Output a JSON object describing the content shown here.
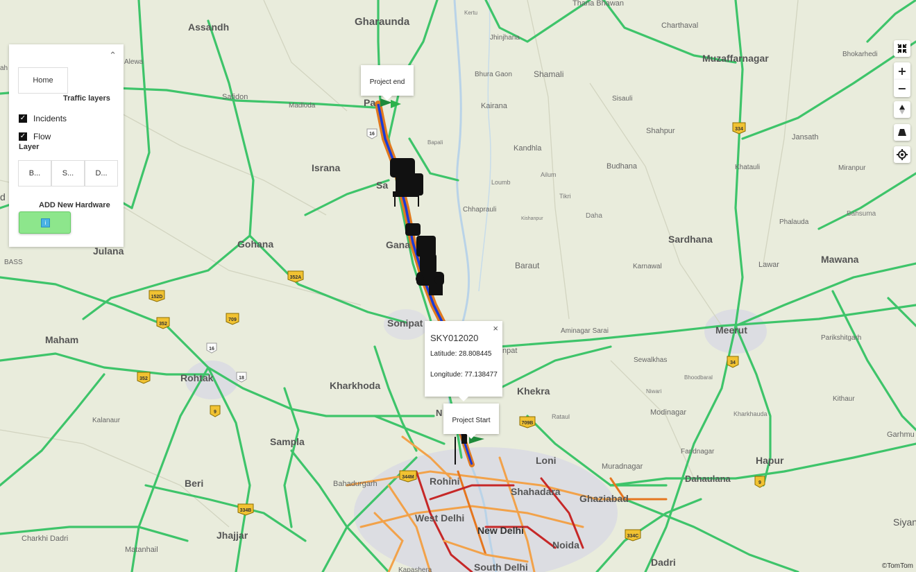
{
  "panel": {
    "home_label": "Home",
    "traffic_layers_title": "Traffic layers",
    "incidents_label": "Incidents",
    "flow_label": "Flow",
    "layer_title": "Layer",
    "layer_buttons": [
      "B...",
      "S...",
      "D..."
    ],
    "add_hardware_label": "ADD New Hardware"
  },
  "popups": {
    "project_end": "Project end",
    "project_start": "Project Start",
    "device": {
      "title": "SKY012020",
      "latitude": "Latitude: 28.808445",
      "longitude": "Longitude: 77.138477",
      "close": "×"
    }
  },
  "attribution": "©TomTom",
  "colors": {
    "highway": "#3ec46a",
    "route": "#e07a20",
    "route_core": "#1a3ad6",
    "traffic_orange": "#f2a24a",
    "traffic_red": "#c62828",
    "button_green": "#8de68c"
  },
  "icons": [
    "collapse-icon",
    "fullscreen-exit-icon",
    "zoom-in-icon",
    "zoom-out-icon",
    "compass-icon",
    "pitch-icon",
    "locate-icon"
  ],
  "places": [
    {
      "name": "Gharaunda",
      "size": "city"
    },
    {
      "name": "Assandh",
      "size": "city"
    },
    {
      "name": "Muzaffarnagar",
      "size": "city"
    },
    {
      "name": "Charthaval",
      "size": "town"
    },
    {
      "name": "Bhokarhedi",
      "size": "town"
    },
    {
      "name": "Kertu",
      "size": "small"
    },
    {
      "name": "Thana Bhawan",
      "size": "town"
    },
    {
      "name": "Jhinjhana",
      "size": "town"
    },
    {
      "name": "Bhura Gaon",
      "size": "town"
    },
    {
      "name": "Shamali",
      "size": "city"
    },
    {
      "name": "Alewa",
      "size": "town"
    },
    {
      "name": "Safidon",
      "size": "town"
    },
    {
      "name": "Madloda",
      "size": "town"
    },
    {
      "name": "Pa",
      "size": "city"
    },
    {
      "name": "Kairana",
      "size": "town"
    },
    {
      "name": "Sisauli",
      "size": "town"
    },
    {
      "name": "Bapali",
      "size": "small"
    },
    {
      "name": "Shahpur",
      "size": "town"
    },
    {
      "name": "Jansath",
      "size": "town"
    },
    {
      "name": "Kandhla",
      "size": "town"
    },
    {
      "name": "Israna",
      "size": "city"
    },
    {
      "name": "Budhana",
      "size": "town"
    },
    {
      "name": "Khatauli",
      "size": "town"
    },
    {
      "name": "Miranpur",
      "size": "town"
    },
    {
      "name": "Sa",
      "size": "city"
    },
    {
      "name": "Loumb",
      "size": "small"
    },
    {
      "name": "Ailum",
      "size": "small"
    },
    {
      "name": "Tikri",
      "size": "small"
    },
    {
      "name": "Chhaprauli",
      "size": "town"
    },
    {
      "name": "Kishanpur",
      "size": "small"
    },
    {
      "name": "Daha",
      "size": "small"
    },
    {
      "name": "Bahsuma",
      "size": "small"
    },
    {
      "name": "Phalauda",
      "size": "town"
    },
    {
      "name": "Gohana",
      "size": "city"
    },
    {
      "name": "Gana",
      "size": "city"
    },
    {
      "name": "Sardhana",
      "size": "city"
    },
    {
      "name": "Julana",
      "size": "city"
    },
    {
      "name": "BASS",
      "size": "small"
    },
    {
      "name": "Baraut",
      "size": "town"
    },
    {
      "name": "Karnawal",
      "size": "town"
    },
    {
      "name": "Lawar",
      "size": "town"
    },
    {
      "name": "Mawana",
      "size": "city"
    },
    {
      "name": "Sonipat",
      "size": "city"
    },
    {
      "name": "Aminagar Sarai",
      "size": "town"
    },
    {
      "name": "Meerut",
      "size": "city"
    },
    {
      "name": "Parikshitgarh",
      "size": "town"
    },
    {
      "name": "Maham",
      "size": "city"
    },
    {
      "name": "npat",
      "size": "town"
    },
    {
      "name": "Sewalkhas",
      "size": "town"
    },
    {
      "name": "Bhoodbaral",
      "size": "small"
    },
    {
      "name": "Rohtak",
      "size": "city"
    },
    {
      "name": "Kharkhoda",
      "size": "city"
    },
    {
      "name": "Khekra",
      "size": "city"
    },
    {
      "name": "Niwari",
      "size": "small"
    },
    {
      "name": "Modinagar",
      "size": "town"
    },
    {
      "name": "Kithaur",
      "size": "town"
    },
    {
      "name": "Kalanaur",
      "size": "town"
    },
    {
      "name": "Rataul",
      "size": "small"
    },
    {
      "name": "Kharkhauda",
      "size": "town"
    },
    {
      "name": "Garhmu",
      "size": "town"
    },
    {
      "name": "Sampla",
      "size": "city"
    },
    {
      "name": "N",
      "size": "city"
    },
    {
      "name": "Loni",
      "size": "city"
    },
    {
      "name": "Faridnagar",
      "size": "town"
    },
    {
      "name": "Muradnagar",
      "size": "town"
    },
    {
      "name": "Hapur",
      "size": "city"
    },
    {
      "name": "Beri",
      "size": "city"
    },
    {
      "name": "Bahadurgarh",
      "size": "town"
    },
    {
      "name": "Rohini",
      "size": "city"
    },
    {
      "name": "Dahaulana",
      "size": "city"
    },
    {
      "name": "Shahadara",
      "size": "city"
    },
    {
      "name": "Ghaziabad",
      "size": "city"
    },
    {
      "name": "West Delhi",
      "size": "city"
    },
    {
      "name": "New Delhi",
      "size": "capital"
    },
    {
      "name": "Siyan",
      "size": "city"
    },
    {
      "name": "Charkhi Dadri",
      "size": "town"
    },
    {
      "name": "Jhajjar",
      "size": "city"
    },
    {
      "name": "Matanhail",
      "size": "town"
    },
    {
      "name": "Noida",
      "size": "city"
    },
    {
      "name": "Dadri",
      "size": "city"
    },
    {
      "name": "Kapashera",
      "size": "town"
    },
    {
      "name": "South Delhi",
      "size": "city"
    }
  ],
  "shields": [
    "16",
    "352A",
    "152D",
    "352",
    "709",
    "16",
    "352",
    "18",
    "9",
    "709B",
    "344M",
    "334B",
    "334C",
    "34",
    "334",
    "9"
  ]
}
